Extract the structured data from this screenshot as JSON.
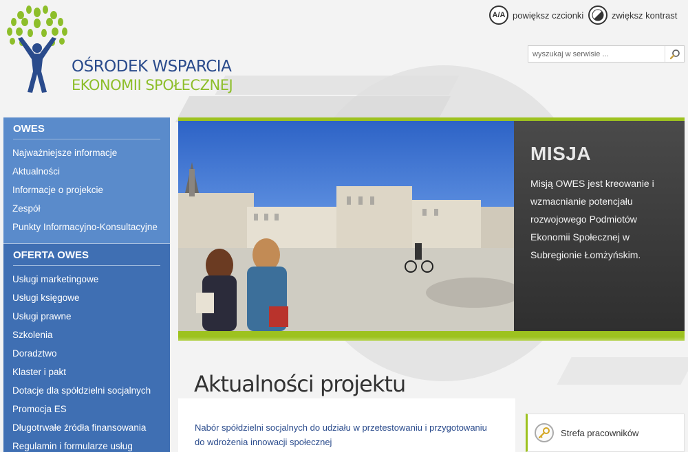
{
  "logo": {
    "line1": "OŚRODEK WSPARCIA",
    "line2": "EKONOMII SPOŁECZNEJ"
  },
  "tools": {
    "font_label": "powiększ czcionki",
    "font_icon": "A/A",
    "contrast_label": "zwiększ kontrast"
  },
  "search": {
    "placeholder": "wyszukaj w serwisie ..."
  },
  "sidebar": {
    "sections": [
      {
        "title": "OWES",
        "items": [
          "Najważniejsze informacje",
          "Aktualności",
          "Informacje o projekcie",
          "Zespół",
          "Punkty Informacyjno-Konsultacyjne"
        ]
      },
      {
        "title": "OFERTA OWES",
        "items": [
          "Usługi marketingowe",
          "Usługi księgowe",
          "Usługi prawne",
          "Szkolenia",
          "Doradztwo",
          "Klaster i pakt",
          "Dotacje dla spółdzielni socjalnych",
          "Promocja ES",
          "Długotrwałe źródła finansowania",
          "Regulamin i formularze usług"
        ]
      }
    ]
  },
  "banner": {
    "heading": "MISJA",
    "text": "Misją OWES jest kreowanie i wzmacnianie potencjału rozwojowego Podmiotów Ekonomii Społecznej w Subregionie Łomżyńskim."
  },
  "news": {
    "title": "Aktualności projektu",
    "items": [
      "Nabór spółdzielni socjalnych do udziału w przetestowaniu i przygotowaniu do wdrożenia innowacji społecznej"
    ]
  },
  "staff": {
    "label": "Strefa pracowników"
  },
  "colors": {
    "blue": "#2a4b8c",
    "green": "#8dbe2a",
    "sidebar": "#4d7ec2"
  }
}
